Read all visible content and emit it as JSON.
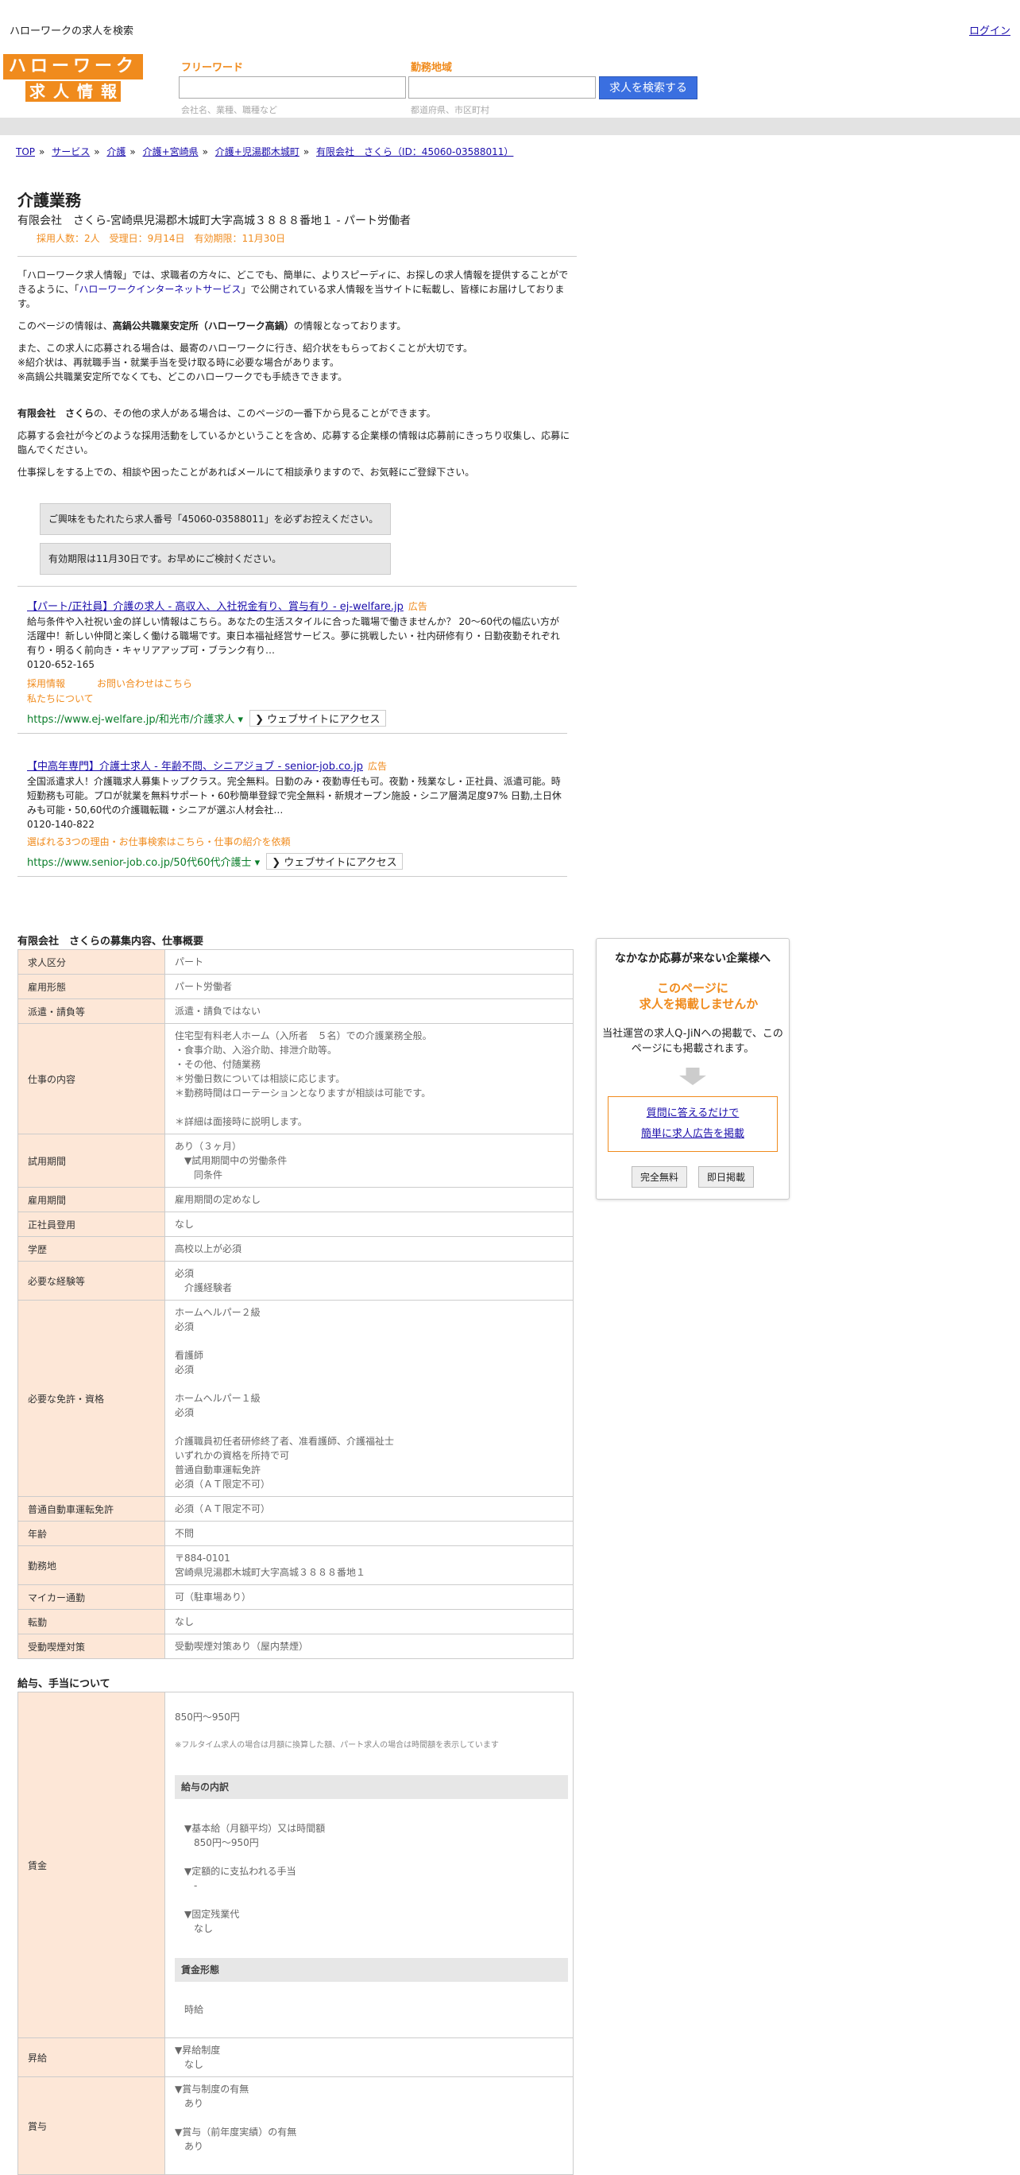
{
  "topbar": {
    "site_name": "ハローワークの求人を検索",
    "login": "ログイン"
  },
  "logo": {
    "line1": "ハローワーク",
    "line2": [
      "求",
      "人",
      "情",
      "報"
    ]
  },
  "search": {
    "keyword_label": "フリーワード",
    "keyword_hint": "会社名、業種、職種など",
    "area_label": "勤務地域",
    "area_hint": "都道府県、市区町村",
    "button": "求人を検索する"
  },
  "breadcrumb": [
    "TOP",
    "サービス",
    "介護",
    "介護+宮崎県",
    "介護+児湯郡木城町",
    "有限会社　さくら（ID：45060-03588011）"
  ],
  "job": {
    "title": "介護業務",
    "subtitle": "有限会社　さくら-宮崎県児湯郡木城町大字高城３８８８番地１ - パート労働者",
    "meta": "採用人数：2人　受理日：9月14日　有効期限：11月30日"
  },
  "intro": {
    "p1_before": "「ハローワーク求人情報」では、求職者の方々に、どこでも、簡単に、よりスピーディに、お探しの求人情報を提供することができるように、「",
    "p1_link": "ハローワークインターネットサービス",
    "p1_after": "」で公開されている求人情報を当サイトに転載し、皆様にお届けしております。",
    "p2_before": "このページの情報は、",
    "p2_bold": "高鍋公共職業安定所（ハローワーク高鍋）",
    "p2_after": "の情報となっております。",
    "p3": "また、この求人に応募される場合は、最寄のハローワークに行き、紹介状をもらっておくことが大切です。\n※紹介状は、再就職手当・就業手当を受け取る時に必要な場合があります。\n※高鍋公共職業安定所でなくても、どこのハローワークでも手続きできます。",
    "p4_bold": "有限会社　さくら",
    "p4_after": "の、その他の求人がある場合は、このページの一番下から見ることができます。",
    "p5": "応募する会社が今どのような採用活動をしているかということを含め、応募する企業様の情報は応募前にきっちり収集し、応募に臨んでください。",
    "p6": "仕事探しをする上での、相談や困ったことがあればメールにて相談承りますので、お気軽にご登録下さい。",
    "box1": "ご興味をもたれたら求人番号「45060-03588011」を必ずお控えください。",
    "box2": "有効期限は11月30日です。お早めにご検討ください。"
  },
  "ads": [
    {
      "title": "【パート/正社員】介護の求人 - 高収入、入社祝金有り、賞与有り - ej-welfare.jp",
      "badge": "広告",
      "desc": "給与条件や入社祝い金の詳しい情報はこちら。あなたの生活スタイルに合った職場で働きませんか？ 20～60代の幅広い方が活躍中！新しい仲間と楽しく働ける職場です。東日本福祉経営サービス。夢に挑戦したい・社内研修有り・日勤夜勤それぞれ有り・明るく前向き・キャリアアップ可・ブランク有り…",
      "phone": "0120-652-165",
      "links": [
        "採用情報",
        "お問い合わせはこちら",
        "私たちについて"
      ],
      "url": "https://www.ej-welfare.jp/和光市/介護求人",
      "visit": "❯ ウェブサイトにアクセス"
    },
    {
      "title": "【中高年専門】介護士求人 - 年齢不問、シニアジョブ - senior-job.co.jp",
      "badge": "広告",
      "desc": "全国派遣求人！介護職求人募集トップクラス。完全無料。日勤のみ・夜勤専任も可。夜勤・残業なし・正社員、派遣可能。時短勤務も可能。プロが就業を無料サポート・60秒簡単登録で完全無料・新規オープン施設・シニア層満足度97% 日勤,土日休みも可能・50,60代の介護職転職・シニアが選ぶ人材会社…",
      "phone": "0120-140-822",
      "links": [
        "選ばれる3つの理由・お仕事検索はこちら・仕事の紹介を依頼"
      ],
      "url": "https://www.senior-job.co.jp/50代60代介護士",
      "visit": "❯ ウェブサイトにアクセス"
    }
  ],
  "overview": {
    "title": "有限会社　さくらの募集内容、仕事概要",
    "rows": [
      {
        "k": "求人区分",
        "v": "パート"
      },
      {
        "k": "雇用形態",
        "v": "パート労働者"
      },
      {
        "k": "派遣・請負等",
        "v": "派遣・請負ではない"
      },
      {
        "k": "仕事の内容",
        "v": "住宅型有料老人ホーム（入所者　５名）での介護業務全般。\n・食事介助、入浴介助、排泄介助等。\n・その他、付随業務\n＊労働日数については相談に応じます。\n＊勤務時間はローテーションとなりますが相談は可能です。\n\n＊詳細は面接時に説明します。"
      },
      {
        "k": "試用期間",
        "v": "あり（３ヶ月）\n　▼試用期間中の労働条件\n　　同条件"
      },
      {
        "k": "雇用期間",
        "v": "雇用期間の定めなし"
      },
      {
        "k": "正社員登用",
        "v": "なし"
      },
      {
        "k": "学歴",
        "v": "高校以上が必須"
      },
      {
        "k": "必要な経験等",
        "v": "必須\n　介護経験者"
      },
      {
        "k": "必要な免許・資格",
        "v": "ホームヘルパー２級\n必須\n\n看護師\n必須\n\nホームヘルパー１級\n必須\n\n介護職員初任者研修終了者、准看護師、介護福祉士\nいずれかの資格を所持で可\n普通自動車運転免許\n必須（ＡＴ限定不可）"
      },
      {
        "k": "普通自動車運転免許",
        "v": "必須（ＡＴ限定不可）"
      },
      {
        "k": "年齢",
        "v": "不問"
      },
      {
        "k": "勤務地",
        "v": "〒884-0101\n宮崎県児湯郡木城町大字高城３８８８番地１"
      },
      {
        "k": "マイカー通勤",
        "v": "可（駐車場あり）"
      },
      {
        "k": "転勤",
        "v": "なし"
      },
      {
        "k": "受動喫煙対策",
        "v": "受動喫煙対策あり（屋内禁煙）"
      }
    ]
  },
  "salary": {
    "title": "給与、手当について",
    "wage_label": "賃金",
    "wage_range": "850円〜950円",
    "wage_note": "※フルタイム求人の場合は月額に換算した額、パート求人の場合は時間額を表示しています",
    "breakdown_head": "給与の内訳",
    "breakdown": "　▼基本給（月額平均）又は時間額\n　　850円〜950円\n\n　▼定額的に支払われる手当\n　　-\n\n　▼固定残業代\n　　なし",
    "form_head": "賃金形態",
    "form_value": "時給",
    "raise_label": "昇給",
    "raise_value": "▼昇給制度\n　なし",
    "bonus_label": "賞与",
    "bonus_value": "▼賞与制度の有無\n　あり\n\n▼賞与（前年度実績）の有無\n　あり"
  },
  "sidebar": {
    "title": "なかなか応募が来ない企業様へ",
    "lead": "このページに\n　求人を掲載しませんか",
    "desc": "当社運営の求人Q-JiNへの掲載で、このページにも掲載されます。",
    "cta1": "質問に答えるだけで",
    "cta2": "簡単に求人広告を掲載",
    "btn1": "完全無料",
    "btn2": "即日掲載"
  }
}
